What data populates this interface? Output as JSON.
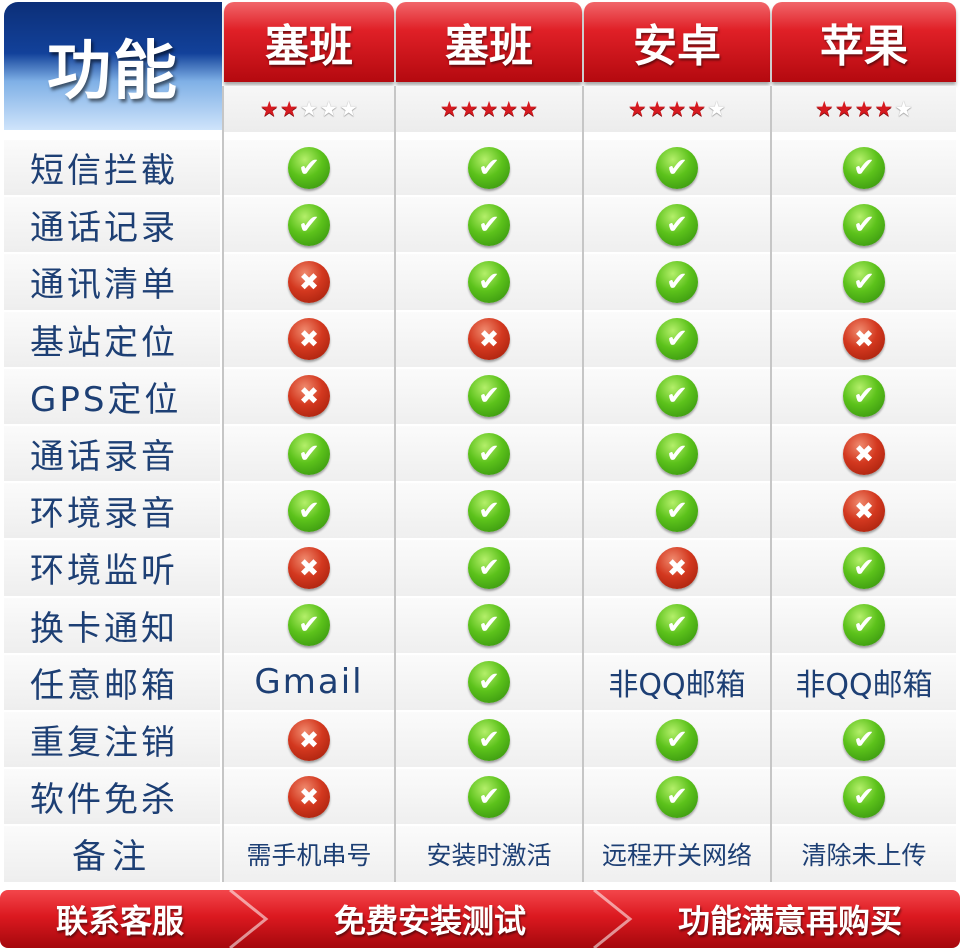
{
  "header": {
    "feature_title": "功能",
    "columns": [
      {
        "name": "塞班",
        "stars": 2
      },
      {
        "name": "塞班",
        "stars": 5
      },
      {
        "name": "安卓",
        "stars": 4
      },
      {
        "name": "苹果",
        "stars": 4
      }
    ],
    "max_stars": 5
  },
  "rows": [
    {
      "label": "短信拦截",
      "cells": [
        "yes",
        "yes",
        "yes",
        "yes"
      ]
    },
    {
      "label": "通话记录",
      "cells": [
        "yes",
        "yes",
        "yes",
        "yes"
      ]
    },
    {
      "label": "通讯清单",
      "cells": [
        "no",
        "yes",
        "yes",
        "yes"
      ]
    },
    {
      "label": "基站定位",
      "cells": [
        "no",
        "no",
        "yes",
        "no"
      ]
    },
    {
      "label": "GPS定位",
      "cells": [
        "no",
        "yes",
        "yes",
        "yes"
      ]
    },
    {
      "label": "通话录音",
      "cells": [
        "yes",
        "yes",
        "yes",
        "no"
      ]
    },
    {
      "label": "环境录音",
      "cells": [
        "yes",
        "yes",
        "yes",
        "no"
      ]
    },
    {
      "label": "环境监听",
      "cells": [
        "no",
        "yes",
        "no",
        "yes"
      ]
    },
    {
      "label": "换卡通知",
      "cells": [
        "yes",
        "yes",
        "yes",
        "yes"
      ]
    },
    {
      "label": "任意邮箱",
      "cells": [
        "Gmail",
        "yes",
        "非QQ邮箱",
        "非QQ邮箱"
      ]
    },
    {
      "label": "重复注销",
      "cells": [
        "no",
        "yes",
        "yes",
        "yes"
      ]
    },
    {
      "label": "软件免杀",
      "cells": [
        "no",
        "yes",
        "yes",
        "yes"
      ]
    },
    {
      "label": "备注",
      "cells": [
        "需手机串号",
        "安装时激活",
        "远程开关网络",
        "清除未上传"
      ],
      "note": true
    }
  ],
  "footer": {
    "items": [
      "联系客服",
      "免费安装测试",
      "功能满意再购买"
    ]
  },
  "icons": {
    "yes": "check-icon",
    "no": "cross-icon",
    "star_on": "star-filled-icon",
    "star_off": "star-empty-icon"
  },
  "colors": {
    "header_red": "#e02027",
    "label_blue": "#1d3f74",
    "check_green": "#5cc21b",
    "cross_red": "#d3381f"
  }
}
